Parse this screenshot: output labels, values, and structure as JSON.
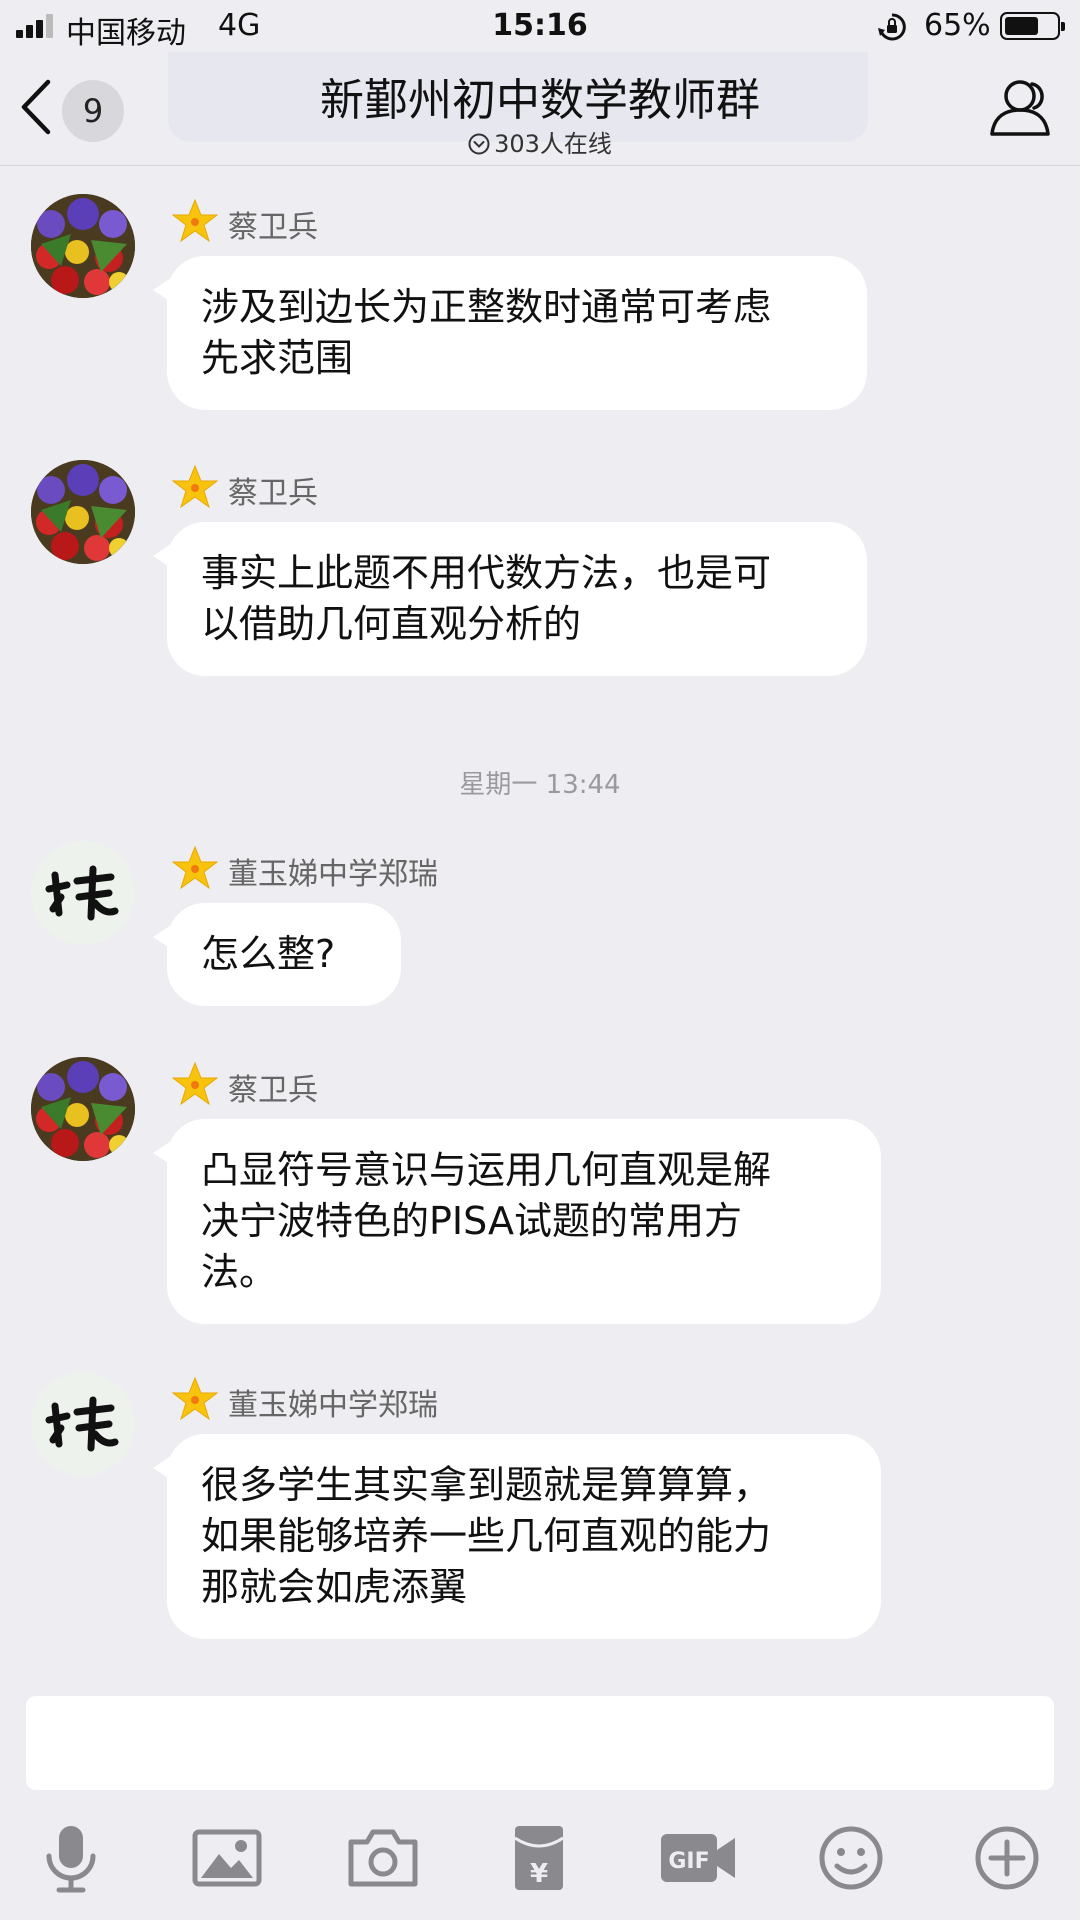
{
  "status_bar": {
    "carrier": "中国移动",
    "network": "4G",
    "time": "15:16",
    "battery_percent": "65%",
    "battery_level": 0.65,
    "icons": [
      "signal-icon",
      "orientation-lock-icon",
      "battery-icon"
    ]
  },
  "nav": {
    "unread_count": "9",
    "title": "新鄞州初中数学教师群",
    "online": "303人在线",
    "icons": [
      "back-icon",
      "chevron-circle-icon",
      "members-icon"
    ]
  },
  "messages": [
    {
      "sender": "蔡卫兵",
      "avatar": "flowers-avatar",
      "lines": [
        "涉及到边长为正整数时通常可考虑",
        "先求范围"
      ]
    },
    {
      "sender": "蔡卫兵",
      "avatar": "flowers-avatar",
      "lines": [
        "事实上此题不用代数方法，也是可",
        "以借助几何直观分析的"
      ]
    },
    {
      "sender": "董玉娣中学郑瑞",
      "avatar": "calligraphy-avatar",
      "lines": [
        "怎么整?"
      ]
    },
    {
      "sender": "蔡卫兵",
      "avatar": "flowers-avatar",
      "lines": [
        "凸显符号意识与运用几何直观是解",
        "决宁波特色的PISA试题的常用方",
        "法。"
      ]
    },
    {
      "sender": "董玉娣中学郑瑞",
      "avatar": "calligraphy-avatar",
      "lines": [
        "很多学生其实拿到题就是算算算，",
        "如果能够培养一些几何直观的能力",
        "那就会如虎添翼"
      ]
    }
  ],
  "timestamp": "星期一 13:44",
  "input": {
    "value": "",
    "placeholder": ""
  },
  "toolbar": {
    "gif_label": "GIF",
    "yuan_label": "¥",
    "icons": [
      "microphone-icon",
      "image-icon",
      "camera-icon",
      "red-packet-icon",
      "gif-icon",
      "emoji-icon",
      "plus-icon"
    ]
  },
  "colors": {
    "background": "#eeeef2",
    "bubble": "#ffffff",
    "star": "#f7c30c",
    "icon_gray": "#8a8a8e"
  }
}
